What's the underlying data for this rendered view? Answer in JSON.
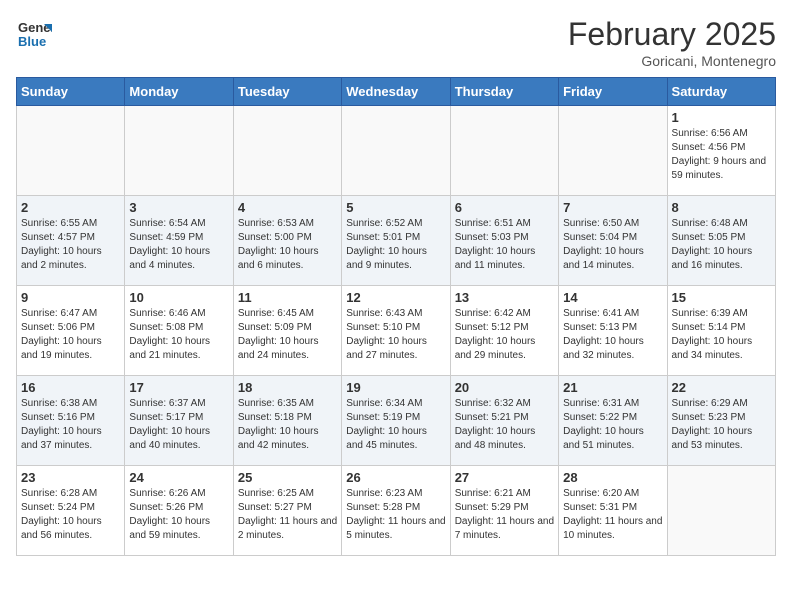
{
  "logo": {
    "general": "General",
    "blue": "Blue"
  },
  "title": {
    "month_year": "February 2025",
    "location": "Goricani, Montenegro"
  },
  "weekdays": [
    "Sunday",
    "Monday",
    "Tuesday",
    "Wednesday",
    "Thursday",
    "Friday",
    "Saturday"
  ],
  "weeks": [
    [
      {
        "day": "",
        "info": ""
      },
      {
        "day": "",
        "info": ""
      },
      {
        "day": "",
        "info": ""
      },
      {
        "day": "",
        "info": ""
      },
      {
        "day": "",
        "info": ""
      },
      {
        "day": "",
        "info": ""
      },
      {
        "day": "1",
        "info": "Sunrise: 6:56 AM\nSunset: 4:56 PM\nDaylight: 9 hours and 59 minutes."
      }
    ],
    [
      {
        "day": "2",
        "info": "Sunrise: 6:55 AM\nSunset: 4:57 PM\nDaylight: 10 hours and 2 minutes."
      },
      {
        "day": "3",
        "info": "Sunrise: 6:54 AM\nSunset: 4:59 PM\nDaylight: 10 hours and 4 minutes."
      },
      {
        "day": "4",
        "info": "Sunrise: 6:53 AM\nSunset: 5:00 PM\nDaylight: 10 hours and 6 minutes."
      },
      {
        "day": "5",
        "info": "Sunrise: 6:52 AM\nSunset: 5:01 PM\nDaylight: 10 hours and 9 minutes."
      },
      {
        "day": "6",
        "info": "Sunrise: 6:51 AM\nSunset: 5:03 PM\nDaylight: 10 hours and 11 minutes."
      },
      {
        "day": "7",
        "info": "Sunrise: 6:50 AM\nSunset: 5:04 PM\nDaylight: 10 hours and 14 minutes."
      },
      {
        "day": "8",
        "info": "Sunrise: 6:48 AM\nSunset: 5:05 PM\nDaylight: 10 hours and 16 minutes."
      }
    ],
    [
      {
        "day": "9",
        "info": "Sunrise: 6:47 AM\nSunset: 5:06 PM\nDaylight: 10 hours and 19 minutes."
      },
      {
        "day": "10",
        "info": "Sunrise: 6:46 AM\nSunset: 5:08 PM\nDaylight: 10 hours and 21 minutes."
      },
      {
        "day": "11",
        "info": "Sunrise: 6:45 AM\nSunset: 5:09 PM\nDaylight: 10 hours and 24 minutes."
      },
      {
        "day": "12",
        "info": "Sunrise: 6:43 AM\nSunset: 5:10 PM\nDaylight: 10 hours and 27 minutes."
      },
      {
        "day": "13",
        "info": "Sunrise: 6:42 AM\nSunset: 5:12 PM\nDaylight: 10 hours and 29 minutes."
      },
      {
        "day": "14",
        "info": "Sunrise: 6:41 AM\nSunset: 5:13 PM\nDaylight: 10 hours and 32 minutes."
      },
      {
        "day": "15",
        "info": "Sunrise: 6:39 AM\nSunset: 5:14 PM\nDaylight: 10 hours and 34 minutes."
      }
    ],
    [
      {
        "day": "16",
        "info": "Sunrise: 6:38 AM\nSunset: 5:16 PM\nDaylight: 10 hours and 37 minutes."
      },
      {
        "day": "17",
        "info": "Sunrise: 6:37 AM\nSunset: 5:17 PM\nDaylight: 10 hours and 40 minutes."
      },
      {
        "day": "18",
        "info": "Sunrise: 6:35 AM\nSunset: 5:18 PM\nDaylight: 10 hours and 42 minutes."
      },
      {
        "day": "19",
        "info": "Sunrise: 6:34 AM\nSunset: 5:19 PM\nDaylight: 10 hours and 45 minutes."
      },
      {
        "day": "20",
        "info": "Sunrise: 6:32 AM\nSunset: 5:21 PM\nDaylight: 10 hours and 48 minutes."
      },
      {
        "day": "21",
        "info": "Sunrise: 6:31 AM\nSunset: 5:22 PM\nDaylight: 10 hours and 51 minutes."
      },
      {
        "day": "22",
        "info": "Sunrise: 6:29 AM\nSunset: 5:23 PM\nDaylight: 10 hours and 53 minutes."
      }
    ],
    [
      {
        "day": "23",
        "info": "Sunrise: 6:28 AM\nSunset: 5:24 PM\nDaylight: 10 hours and 56 minutes."
      },
      {
        "day": "24",
        "info": "Sunrise: 6:26 AM\nSunset: 5:26 PM\nDaylight: 10 hours and 59 minutes."
      },
      {
        "day": "25",
        "info": "Sunrise: 6:25 AM\nSunset: 5:27 PM\nDaylight: 11 hours and 2 minutes."
      },
      {
        "day": "26",
        "info": "Sunrise: 6:23 AM\nSunset: 5:28 PM\nDaylight: 11 hours and 5 minutes."
      },
      {
        "day": "27",
        "info": "Sunrise: 6:21 AM\nSunset: 5:29 PM\nDaylight: 11 hours and 7 minutes."
      },
      {
        "day": "28",
        "info": "Sunrise: 6:20 AM\nSunset: 5:31 PM\nDaylight: 11 hours and 10 minutes."
      },
      {
        "day": "",
        "info": ""
      }
    ]
  ]
}
